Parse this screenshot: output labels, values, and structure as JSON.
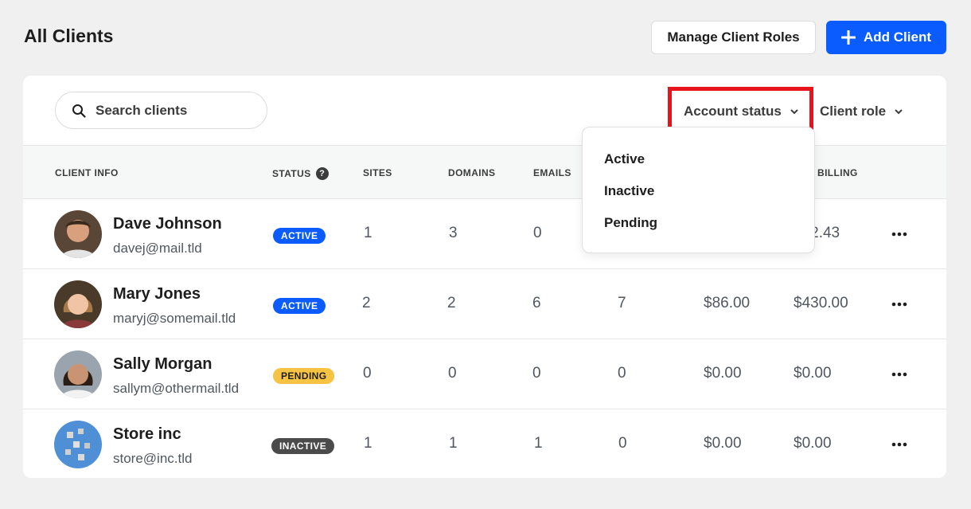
{
  "header": {
    "title": "All Clients",
    "manage_roles_label": "Manage Client Roles",
    "add_client_label": "Add Client"
  },
  "toolbar": {
    "search_placeholder": "Search clients",
    "account_status_label": "Account status",
    "client_role_label": "Client role"
  },
  "table": {
    "columns": {
      "client_info": "CLIENT INFO",
      "status": "STATUS",
      "sites": "SITES",
      "domains": "DOMAINS",
      "emails": "EMAILS",
      "billing": "BILLING"
    },
    "rows": [
      {
        "name": "Dave Johnson",
        "email": "davej@mail.tld",
        "status": "ACTIVE",
        "sites": "1",
        "domains": "3",
        "emails": "0",
        "col4": "",
        "col5": "",
        "billing": "$92.43"
      },
      {
        "name": "Mary Jones",
        "email": "maryj@somemail.tld",
        "status": "ACTIVE",
        "sites": "2",
        "domains": "2",
        "emails": "6",
        "col4": "7",
        "col5": "$86.00",
        "billing": "$430.00"
      },
      {
        "name": "Sally Morgan",
        "email": "sallym@othermail.tld",
        "status": "PENDING",
        "sites": "0",
        "domains": "0",
        "emails": "0",
        "col4": "0",
        "col5": "$0.00",
        "billing": "$0.00"
      },
      {
        "name": "Store inc",
        "email": "store@inc.tld",
        "status": "INACTIVE",
        "sites": "1",
        "domains": "1",
        "emails": "1",
        "col4": "0",
        "col5": "$0.00",
        "billing": "$0.00"
      }
    ]
  },
  "status_dropdown": {
    "options": [
      "Active",
      "Inactive",
      "Pending"
    ]
  },
  "colors": {
    "primary": "#0a5cff",
    "highlight": "#e8141c",
    "pending": "#f6c342",
    "inactive": "#4b4b4b"
  }
}
